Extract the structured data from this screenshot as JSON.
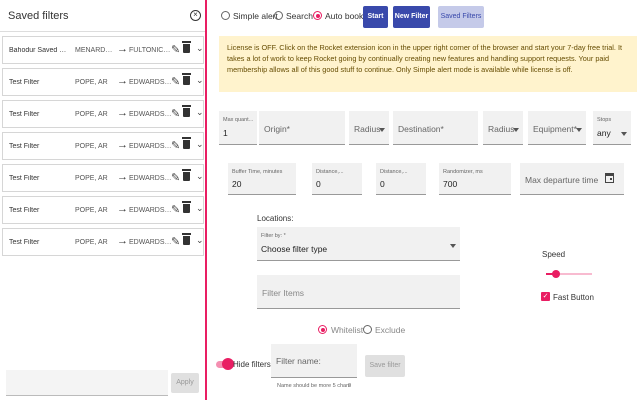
{
  "left_panel": {
    "title": "Saved filters",
    "close_glyph": "×",
    "filters": [
      {
        "name": "Bahodur Saved Filter",
        "origin": "MENARDAN...",
        "destination": "FULTONICAT..."
      },
      {
        "name": "Test Filter",
        "origin": "POPE, AR",
        "destination": "EDWARDS, TX"
      },
      {
        "name": "Test Filter",
        "origin": "POPE, AR",
        "destination": "EDWARDS, TX"
      },
      {
        "name": "Test Filter",
        "origin": "POPE, AR",
        "destination": "EDWARDS, TX"
      },
      {
        "name": "Test Filter",
        "origin": "POPE, AR",
        "destination": "EDWARDS, TX"
      },
      {
        "name": "Test Filter",
        "origin": "POPE, AR",
        "destination": "EDWARDS, TX"
      },
      {
        "name": "Test Filter",
        "origin": "POPE, AR",
        "destination": "EDWARDS, TX"
      }
    ],
    "arrow_glyph": "→",
    "edit_glyph": "✎",
    "chevron_glyph": "⌄",
    "apply_label": "Apply"
  },
  "mode": {
    "options": [
      "Simple alert",
      "Search",
      "Auto book"
    ],
    "selected": "Auto book"
  },
  "toolbar": {
    "start_label": "Start",
    "new_filter_label": "New Filter",
    "saved_filters_label": "Saved Filters"
  },
  "notice": {
    "text": "License is OFF. Click on the Rocket extension icon in the upper right corner of the browser and start your 7-day free trial. It takes a lot of work to keep Rocket going by continually creating new features and handling support requests. Your paid membership allows all of this good stuff to continue. Only Simple alert mode is available while license is off."
  },
  "form": {
    "max_quantity": {
      "label": "Max quant...",
      "value": "1"
    },
    "origin": {
      "placeholder": "Origin*"
    },
    "origin_radius": {
      "label": "Radius"
    },
    "destination": {
      "placeholder": "Destination*"
    },
    "destination_radius": {
      "label": "Radius"
    },
    "equipment": {
      "label": "Equipment*"
    },
    "stops": {
      "label": "Stops",
      "value": "any"
    },
    "buffer_time": {
      "label": "Buffer Time, minutes",
      "value": "20"
    },
    "distance_min": {
      "label": "Distance,...",
      "value": "0"
    },
    "distance_max": {
      "label": "Distance,...",
      "value": "0"
    },
    "randomizer": {
      "label": "Randomizer, ms",
      "value": "700"
    },
    "max_departure": {
      "placeholder": "Max departure time"
    },
    "locations_label": "Locations:",
    "filter_by": {
      "label": "Filter by: *",
      "value": "Choose filter type"
    },
    "filter_items": {
      "placeholder": "Filter Items"
    },
    "list_mode": {
      "options": [
        "Whitelist",
        "Exclude"
      ],
      "selected": "Whitelist"
    },
    "speed_label": "Speed",
    "speed_value": 0.22,
    "fast_button_label": "Fast Button",
    "fast_button_checked": true,
    "hide_filters_label": "Hide filters",
    "filter_name": {
      "placeholder": "Filter name:"
    },
    "filter_name_hint": "Name should be more 5 chars",
    "filter_name_count": "0",
    "save_filter_label": "Save filter"
  },
  "colors": {
    "accent": "#e91e63",
    "primary": "#3949ab",
    "notice_bg": "#fff3cd"
  }
}
